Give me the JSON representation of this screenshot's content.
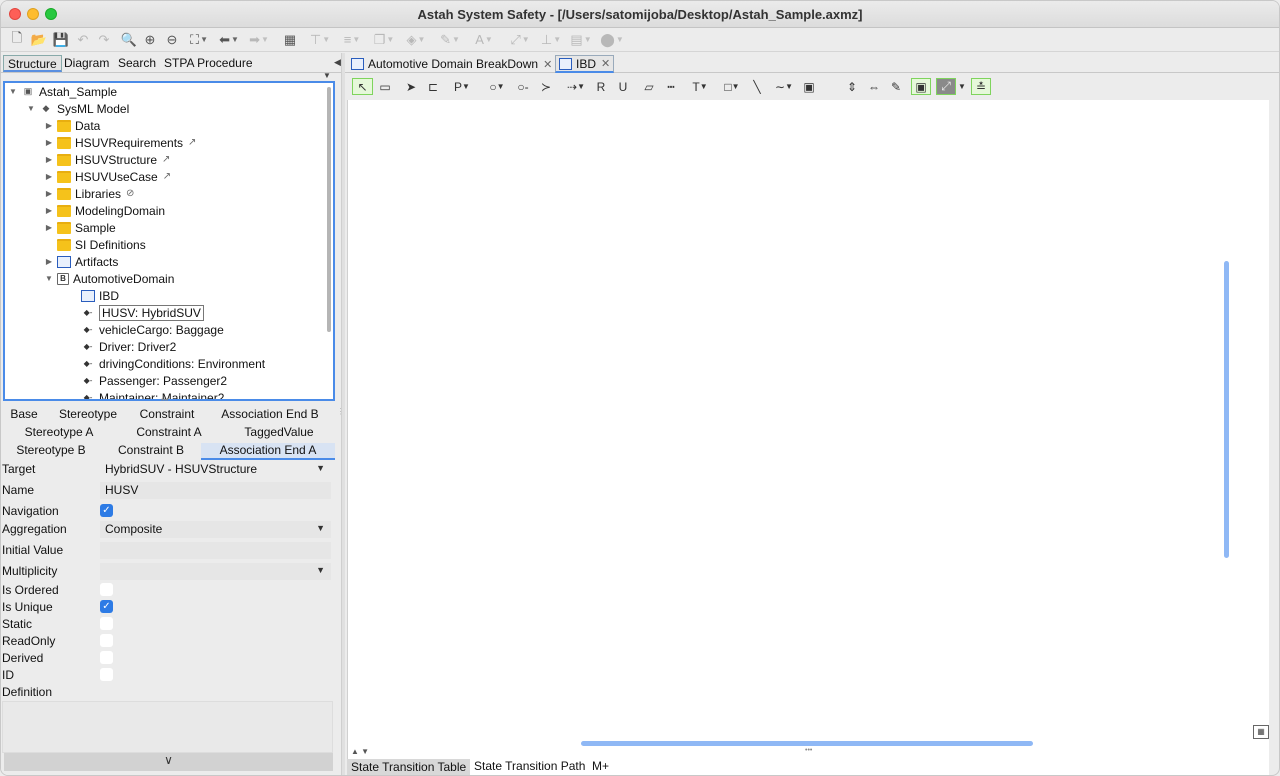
{
  "window": {
    "title": "Astah System Safety - [/Users/satomijoba/Desktop/Astah_Sample.axmz]"
  },
  "left_tabs": [
    "Structure",
    "Diagram",
    "Search",
    "STPA Procedure"
  ],
  "tree": {
    "root": "Astah_Sample",
    "model": "SysML Model",
    "items": [
      {
        "label": "Data",
        "kind": "folder",
        "expand": "▶"
      },
      {
        "label": "HSUVRequirements",
        "kind": "folder",
        "expand": "▶",
        "link": "↗"
      },
      {
        "label": "HSUVStructure",
        "kind": "folder",
        "expand": "▶",
        "link": "↗"
      },
      {
        "label": "HSUVUseCase",
        "kind": "folder",
        "expand": "▶",
        "link": "↗"
      },
      {
        "label": "Libraries",
        "kind": "folder",
        "expand": "▶",
        "link": "⊘"
      },
      {
        "label": "ModelingDomain",
        "kind": "folder",
        "expand": "▶"
      },
      {
        "label": "Sample",
        "kind": "folder",
        "expand": "▶"
      },
      {
        "label": "SI Definitions",
        "kind": "folder",
        "expand": ""
      },
      {
        "label": "Artifacts",
        "kind": "artifact",
        "expand": "▶"
      },
      {
        "label": "AutomotiveDomain",
        "kind": "block",
        "expand": "▼"
      }
    ],
    "children": [
      {
        "label": "IBD",
        "kind": "diagram"
      },
      {
        "label": "HUSV: HybridSUV",
        "kind": "part",
        "selected": true
      },
      {
        "label": "vehicleCargo: Baggage",
        "kind": "part"
      },
      {
        "label": "Driver: Driver2",
        "kind": "part"
      },
      {
        "label": "drivingConditions: Environment",
        "kind": "part"
      },
      {
        "label": "Passenger: Passenger2",
        "kind": "part"
      },
      {
        "label": "Maintainer: Maintainer2",
        "kind": "part"
      }
    ]
  },
  "prop_tabs": {
    "row1": [
      "Base",
      "Stereotype",
      "Constraint",
      "Association End B"
    ],
    "row2": [
      "Stereotype A",
      "Constraint A",
      "TaggedValue"
    ],
    "row3": [
      "Stereotype B",
      "Constraint B",
      "Association End A"
    ]
  },
  "props": {
    "target": {
      "label": "Target",
      "value": "HybridSUV - HSUVStructure"
    },
    "name": {
      "label": "Name",
      "value": "HUSV"
    },
    "navigation": {
      "label": "Navigation",
      "checked": true
    },
    "aggregation": {
      "label": "Aggregation",
      "value": "Composite"
    },
    "initial_value": {
      "label": "Initial Value",
      "value": ""
    },
    "multiplicity": {
      "label": "Multiplicity",
      "value": ""
    },
    "is_ordered": {
      "label": "Is Ordered",
      "checked": false
    },
    "is_unique": {
      "label": "Is Unique",
      "checked": true
    },
    "static": {
      "label": "Static",
      "checked": false
    },
    "readonly": {
      "label": "ReadOnly",
      "checked": false
    },
    "derived": {
      "label": "Derived",
      "checked": false
    },
    "id": {
      "label": "ID",
      "checked": false
    },
    "definition": {
      "label": "Definition"
    }
  },
  "diagram_tabs": [
    {
      "label": "Automotive Domain BreakDown",
      "close": "✕"
    },
    {
      "label": "IBD",
      "close": "✕"
    }
  ],
  "bottom_tabs": [
    "State Transition Table",
    "State Transition Path",
    "M+"
  ],
  "glyphs": {
    "chevron": "∨",
    "check": "✓",
    "dropdown": "▼"
  }
}
